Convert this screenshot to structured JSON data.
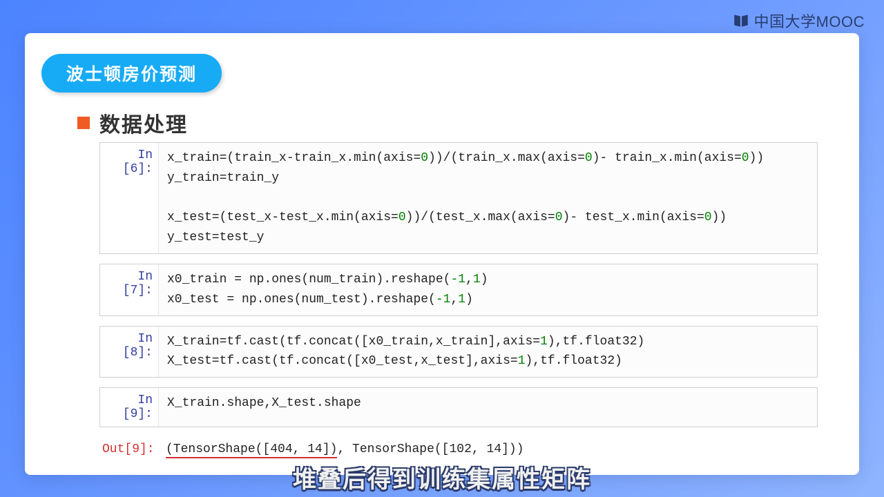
{
  "watermark": "中国大学MOOC",
  "title_pill": "波士顿房价预测",
  "section_label": "数据处理",
  "caption": "堆叠后得到训练集属性矩阵",
  "cells": {
    "in6_prompt": "In [6]:",
    "in6_l1a": "x_train=(train_x-train_x.min(axis=",
    "in6_l1b": "))/(train_x.max(axis=",
    "in6_l1c": ")- train_x.min(axis=",
    "in6_l1d": "))",
    "in6_l2": "y_train=train_y",
    "in6_l3a": "x_test=(test_x-test_x.min(axis=",
    "in6_l3b": "))/(test_x.max(axis=",
    "in6_l3c": ")- test_x.min(axis=",
    "in6_l3d": "))",
    "in6_l4": "y_test=test_y",
    "in7_prompt": "In [7]:",
    "in7_l1a": "x0_train = np.ones(num_train).reshape(",
    "in7_l1b": ")",
    "in7_l2a": "x0_test = np.ones(num_test).reshape(",
    "in7_l2b": ")",
    "in8_prompt": "In [8]:",
    "in8_l1a": "X_train=tf.cast(tf.concat([x0_train,x_train],axis=",
    "in8_l1b": "),tf.float32)",
    "in8_l2a": "X_test=tf.cast(tf.concat([x0_test,x_test],axis=",
    "in8_l2b": "),tf.float32)",
    "in9_prompt": "In [9]:",
    "in9_code": "X_train.shape,X_test.shape",
    "out9_prompt": "Out[9]:",
    "out9_hl": "(TensorShape([404, 14])",
    "out9_rest": ", TensorShape([102, 14]))"
  },
  "ints": {
    "zero": "0",
    "one": "1",
    "neg1": "-1"
  }
}
